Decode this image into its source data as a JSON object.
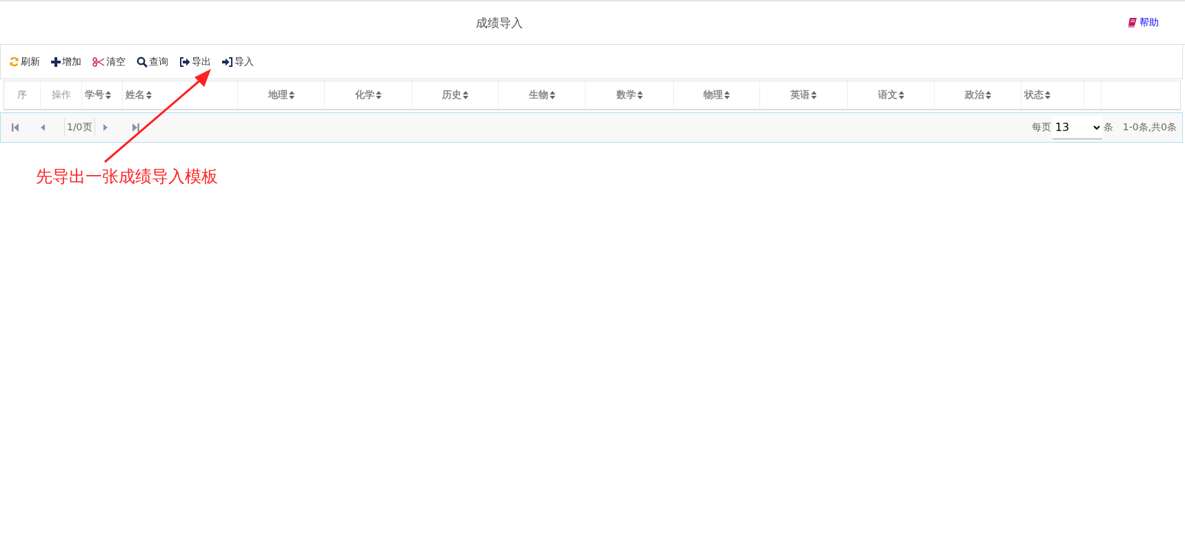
{
  "header": {
    "title": "成绩导入",
    "help": "帮助"
  },
  "toolbar": [
    {
      "kind": "refresh",
      "label": "刷新"
    },
    {
      "kind": "add",
      "label": "增加"
    },
    {
      "kind": "clear",
      "label": "清空"
    },
    {
      "kind": "search",
      "label": "查询"
    },
    {
      "kind": "export",
      "label": "导出"
    },
    {
      "kind": "import",
      "label": "导入"
    }
  ],
  "table": {
    "columns": [
      {
        "label": "序",
        "sortable": false
      },
      {
        "label": "操作",
        "sortable": false
      },
      {
        "label": "学号",
        "sortable": true
      },
      {
        "label": "姓名",
        "sortable": true
      },
      {
        "label": "地理",
        "sortable": true
      },
      {
        "label": "化学",
        "sortable": true
      },
      {
        "label": "历史",
        "sortable": true
      },
      {
        "label": "生物",
        "sortable": true
      },
      {
        "label": "数学",
        "sortable": true
      },
      {
        "label": "物理",
        "sortable": true
      },
      {
        "label": "英语",
        "sortable": true
      },
      {
        "label": "语文",
        "sortable": true
      },
      {
        "label": "政治",
        "sortable": true
      },
      {
        "label": "状态",
        "sortable": true
      }
    ]
  },
  "pager": {
    "page": "1/0页",
    "per_page_label": "每页",
    "per_page": "13",
    "unit": "条",
    "summary": "1-0条,共0条"
  },
  "annotation": {
    "text": "先导出一张成绩导入模板"
  }
}
